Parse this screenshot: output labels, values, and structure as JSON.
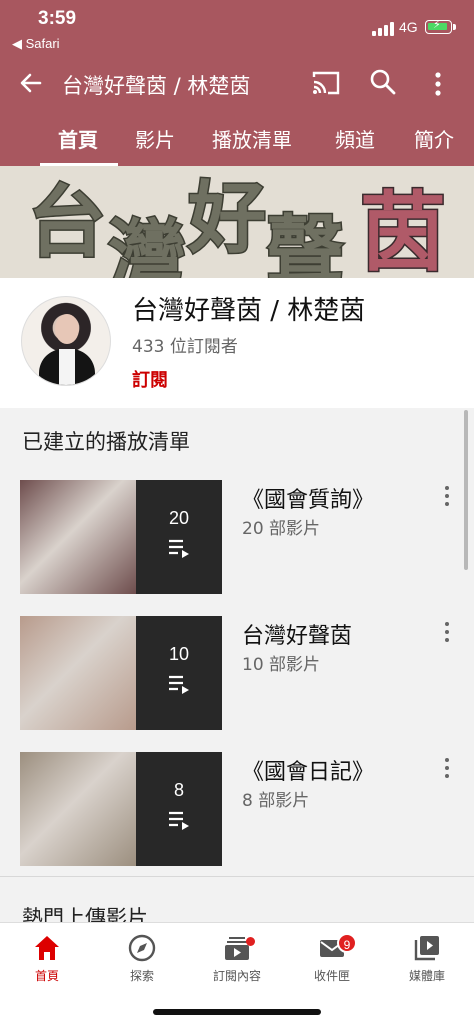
{
  "status": {
    "time": "3:59",
    "back_app": "◀ Safari",
    "network": "4G"
  },
  "header": {
    "title": "台灣好聲茵 / 林楚茵"
  },
  "tabs": [
    "首頁",
    "影片",
    "播放清單",
    "頻道",
    "簡介"
  ],
  "banner": {
    "chars": [
      "台",
      "灣",
      "好",
      "聲",
      "茵"
    ]
  },
  "channel": {
    "name": "台灣好聲茵 / 林楚茵",
    "subscribers": "433 位訂閱者",
    "subscribe_label": "訂閱"
  },
  "playlists_section": {
    "title": "已建立的播放清單",
    "items": [
      {
        "title": "《國會質詢》",
        "count_text": "20 部影片",
        "count": "20",
        "theme": "#6e4d4d"
      },
      {
        "title": "台灣好聲茵",
        "count_text": "10 部影片",
        "count": "10",
        "theme": "#b89b8c"
      },
      {
        "title": "《國會日記》",
        "count_text": "8 部影片",
        "count": "8",
        "theme": "#9c8f7f"
      }
    ]
  },
  "popular_section": {
    "title": "熱門上傳影片"
  },
  "bottom_nav": [
    {
      "label": "首頁",
      "icon": "home-icon",
      "active": true
    },
    {
      "label": "探索",
      "icon": "explore-icon"
    },
    {
      "label": "訂閱內容",
      "icon": "subscriptions-icon"
    },
    {
      "label": "收件匣",
      "icon": "inbox-icon",
      "badge": "9"
    },
    {
      "label": "媒體庫",
      "icon": "library-icon"
    }
  ],
  "colors": {
    "brand_bar": "#a8575f",
    "accent": "#cc0000"
  }
}
